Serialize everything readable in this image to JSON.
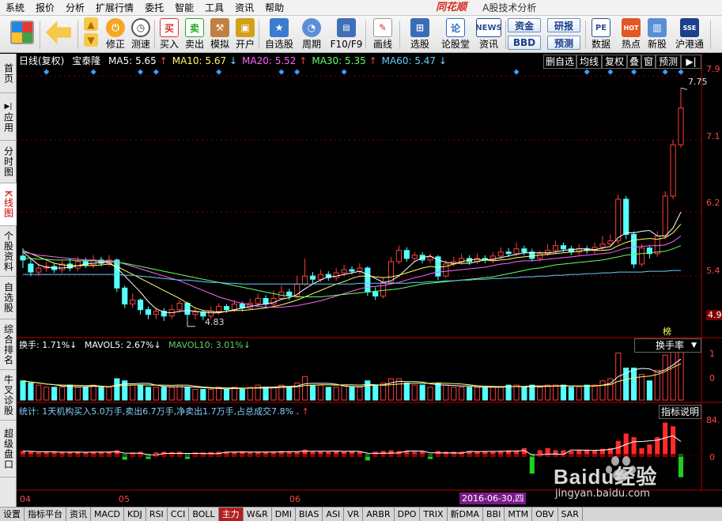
{
  "menu": {
    "items": [
      "系统",
      "报价",
      "分析",
      "扩展行情",
      "委托",
      "智能",
      "工具",
      "资讯",
      "帮助"
    ],
    "brand": "同花顺",
    "app_title": "A股技术分析"
  },
  "toolbar": {
    "buttons": [
      {
        "label": "修正",
        "icon": "fix-icon"
      },
      {
        "label": "测速",
        "icon": "speed-icon"
      },
      {
        "label": "买入",
        "icon": "buy-icon",
        "glyph": "买"
      },
      {
        "label": "卖出",
        "icon": "sell-icon",
        "glyph": "卖"
      },
      {
        "label": "模拟",
        "icon": "hammer-icon"
      },
      {
        "label": "开户",
        "icon": "lock-icon"
      },
      {
        "label": "自选股",
        "icon": "star-icon"
      },
      {
        "label": "周期",
        "icon": "clock-icon"
      },
      {
        "label": "F10/F9",
        "icon": "f10-icon"
      },
      {
        "label": "画线",
        "icon": "pencil-icon"
      },
      {
        "label": "选股",
        "icon": "select-stock-icon"
      },
      {
        "label": "论股堂",
        "icon": "forum-icon",
        "glyph": "论"
      },
      {
        "label": "资讯",
        "icon": "news-icon",
        "glyph": "NEWS"
      },
      {
        "label": "数据",
        "icon": "pe-icon",
        "glyph": "PE"
      },
      {
        "label": "热点",
        "icon": "hot-icon",
        "glyph": "HOT"
      },
      {
        "label": "新股",
        "icon": "ipo-icon"
      },
      {
        "label": "沪港通",
        "icon": "hk-connect-icon"
      }
    ],
    "pills": [
      "资金",
      "研报",
      "BBD",
      "预测"
    ]
  },
  "sidebar": {
    "items": [
      {
        "label": "首页"
      },
      {
        "label": "应用"
      },
      {
        "label": "分时图"
      },
      {
        "label": "K线图",
        "active": true
      },
      {
        "label": "个股资料"
      },
      {
        "label": "自选股"
      },
      {
        "label": "综合排名"
      },
      {
        "label": "牛叉诊股"
      },
      {
        "label": "超级盘口"
      }
    ]
  },
  "price_panel": {
    "period_label": "日线(复权)",
    "stock_name": "宝泰隆",
    "ma": [
      {
        "label": "MA5: 5.65",
        "arrow": "↑",
        "color": "#ffffff"
      },
      {
        "label": "MA10: 5.67",
        "arrow": "↓",
        "color": "#ffff66"
      },
      {
        "label": "MA20: 5.52",
        "arrow": "↑",
        "color": "#ff66ff"
      },
      {
        "label": "MA30: 5.35",
        "arrow": "↑",
        "color": "#66ff66"
      },
      {
        "label": "MA60: 5.47",
        "arrow": "↓",
        "color": "#66ccff"
      }
    ],
    "buttons": [
      "删自选",
      "均线",
      "复权",
      "叠",
      "窗",
      "预测"
    ],
    "y_ticks": [
      "7.9",
      "7.1",
      "6.2",
      "5.4",
      "4.9"
    ],
    "high_label": "7.75",
    "low_label": "4.83",
    "bang_label": "榜"
  },
  "volume_panel": {
    "label": "换手: 1.71%",
    "mavol5": "MAVOL5: 2.67%",
    "mavol10": "MAVOL10: 3.01%",
    "dropdown": "换手率",
    "y_ticks": [
      "1",
      "0"
    ]
  },
  "flow_panel": {
    "stat_text": "统计: 1天机构买入5.0万手,卖出6.7万手,净卖出1.7万手,占总成交7.8%",
    "button": "指标说明",
    "y_ticks": [
      "84.",
      "0"
    ]
  },
  "date_axis": {
    "months": [
      "04",
      "05",
      "06"
    ],
    "cursor_date": "2016-06-30,四"
  },
  "tabs": [
    "设置",
    "指标平台",
    "资讯",
    "MACD",
    "KDJ",
    "RSI",
    "CCI",
    "BOLL",
    "主力",
    "W&R",
    "DMI",
    "BIAS",
    "ASI",
    "VR",
    "ARBR",
    "DPO",
    "TRIX",
    "新DMA",
    "BBI",
    "MTM",
    "OBV",
    "SAR"
  ],
  "selected_tab": "主力",
  "watermark": {
    "text": "Baidu经验",
    "sub": "jingyan.baidu.com"
  },
  "chart_data": {
    "type": "candlestick",
    "symbol": "宝泰隆",
    "price_ylim": [
      4.7,
      8.0
    ],
    "candles": [
      [
        5.65,
        5.6,
        5.75,
        5.5
      ],
      [
        5.55,
        5.45,
        5.62,
        5.4
      ],
      [
        5.45,
        5.5,
        5.55,
        5.4
      ],
      [
        5.5,
        5.52,
        5.58,
        5.45
      ],
      [
        5.52,
        5.48,
        5.56,
        5.44
      ],
      [
        5.48,
        5.55,
        5.6,
        5.44
      ],
      [
        5.55,
        5.5,
        5.62,
        5.46
      ],
      [
        5.5,
        5.58,
        5.64,
        5.46
      ],
      [
        5.58,
        5.54,
        5.63,
        5.5
      ],
      [
        5.54,
        5.6,
        5.66,
        5.5
      ],
      [
        5.6,
        5.56,
        5.64,
        5.52
      ],
      [
        5.56,
        5.6,
        5.66,
        5.52
      ],
      [
        5.6,
        5.25,
        5.62,
        5.2
      ],
      [
        5.25,
        5.05,
        5.28,
        5.0
      ],
      [
        5.05,
        5.1,
        5.18,
        5.0
      ],
      [
        5.1,
        4.98,
        5.12,
        4.92
      ],
      [
        4.98,
        4.92,
        5.02,
        4.86
      ],
      [
        4.92,
        4.96,
        5.0,
        4.86
      ],
      [
        4.96,
        4.9,
        5.0,
        4.84
      ],
      [
        4.9,
        4.98,
        5.04,
        4.86
      ],
      [
        4.98,
        5.06,
        5.1,
        4.94
      ],
      [
        5.06,
        4.92,
        5.08,
        4.83
      ],
      [
        4.92,
        4.95,
        5.0,
        4.86
      ],
      [
        4.95,
        4.9,
        4.98,
        4.85
      ],
      [
        4.9,
        4.96,
        5.02,
        4.86
      ],
      [
        4.96,
        5.02,
        5.06,
        4.92
      ],
      [
        5.02,
        4.98,
        5.05,
        4.94
      ],
      [
        4.98,
        5.05,
        5.1,
        4.95
      ],
      [
        5.05,
        5.0,
        5.08,
        4.96
      ],
      [
        5.0,
        5.06,
        5.12,
        4.98
      ],
      [
        5.06,
        5.12,
        5.18,
        5.02
      ],
      [
        5.12,
        5.05,
        5.16,
        5.0
      ],
      [
        5.05,
        5.12,
        5.22,
        5.02
      ],
      [
        5.12,
        5.2,
        5.28,
        5.1
      ],
      [
        5.2,
        5.15,
        5.24,
        5.1
      ],
      [
        5.15,
        5.3,
        5.4,
        5.12
      ],
      [
        5.3,
        5.4,
        5.62,
        5.28
      ],
      [
        5.4,
        5.36,
        5.45,
        5.3
      ],
      [
        5.36,
        5.42,
        5.48,
        5.32
      ],
      [
        5.42,
        5.38,
        5.46,
        5.34
      ],
      [
        5.38,
        5.44,
        5.5,
        5.34
      ],
      [
        5.44,
        5.48,
        5.54,
        5.4
      ],
      [
        5.48,
        5.46,
        5.52,
        5.42
      ],
      [
        5.46,
        5.5,
        5.56,
        5.42
      ],
      [
        5.5,
        5.2,
        5.52,
        5.15
      ],
      [
        5.2,
        5.15,
        5.26,
        5.1
      ],
      [
        5.15,
        5.32,
        5.38,
        5.12
      ],
      [
        5.32,
        5.58,
        5.64,
        5.3
      ],
      [
        5.58,
        5.72,
        5.78,
        5.55
      ],
      [
        5.72,
        5.62,
        5.76,
        5.58
      ],
      [
        5.62,
        5.66,
        5.7,
        5.58
      ],
      [
        5.66,
        5.6,
        5.7,
        5.56
      ],
      [
        5.6,
        5.64,
        5.68,
        5.56
      ],
      [
        5.64,
        5.4,
        5.66,
        5.35
      ],
      [
        5.4,
        5.55,
        5.6,
        5.38
      ],
      [
        5.55,
        5.58,
        5.64,
        5.52
      ],
      [
        5.58,
        5.62,
        5.68,
        5.54
      ],
      [
        5.62,
        5.58,
        5.66,
        5.54
      ],
      [
        5.58,
        5.62,
        5.68,
        5.55
      ],
      [
        5.62,
        5.6,
        5.66,
        5.56
      ],
      [
        5.6,
        5.65,
        5.7,
        5.56
      ],
      [
        5.65,
        5.7,
        5.76,
        5.6
      ],
      [
        5.7,
        5.68,
        5.75,
        5.64
      ],
      [
        5.68,
        5.74,
        5.82,
        5.65
      ],
      [
        5.74,
        5.7,
        5.78,
        5.66
      ],
      [
        5.7,
        5.62,
        5.74,
        5.58
      ],
      [
        5.62,
        5.68,
        5.72,
        5.58
      ],
      [
        5.68,
        5.72,
        5.8,
        5.65
      ],
      [
        5.72,
        5.78,
        5.84,
        5.68
      ],
      [
        5.78,
        5.74,
        5.82,
        5.7
      ],
      [
        5.74,
        5.7,
        5.78,
        5.66
      ],
      [
        5.7,
        5.74,
        5.8,
        5.66
      ],
      [
        5.74,
        5.72,
        5.78,
        5.68
      ],
      [
        5.72,
        5.76,
        5.82,
        5.68
      ],
      [
        5.76,
        5.8,
        5.9,
        5.72
      ],
      [
        5.8,
        5.84,
        5.92,
        5.76
      ],
      [
        5.84,
        6.36,
        6.42,
        5.8
      ],
      [
        6.36,
        5.92,
        6.4,
        5.86
      ],
      [
        5.92,
        5.55,
        5.96,
        5.5
      ],
      [
        5.55,
        5.75,
        5.8,
        5.52
      ],
      [
        5.75,
        5.68,
        5.78,
        5.62
      ],
      [
        5.68,
        5.9,
        5.96,
        5.64
      ],
      [
        5.9,
        6.4,
        6.46,
        5.86
      ],
      [
        6.4,
        7.04,
        7.1,
        6.36
      ],
      [
        7.04,
        7.5,
        7.75,
        7.0
      ]
    ],
    "ma_lines": [
      {
        "name": "MA5",
        "color": "#ffffff",
        "values": [
          5.7,
          5.62,
          5.54,
          5.51,
          5.5,
          5.5,
          5.51,
          5.53,
          5.55,
          5.56,
          5.57,
          5.57,
          5.5,
          5.4,
          5.3,
          5.2,
          5.08,
          4.99,
          4.95,
          4.94,
          4.96,
          4.97,
          4.96,
          4.95,
          4.94,
          4.94,
          4.96,
          4.98,
          5.0,
          5.02,
          5.04,
          5.05,
          5.07,
          5.11,
          5.13,
          5.17,
          5.24,
          5.3,
          5.35,
          5.39,
          5.4,
          5.42,
          5.44,
          5.46,
          5.42,
          5.37,
          5.32,
          5.34,
          5.4,
          5.49,
          5.58,
          5.63,
          5.65,
          5.6,
          5.57,
          5.56,
          5.56,
          5.56,
          5.58,
          5.6,
          5.61,
          5.63,
          5.65,
          5.67,
          5.69,
          5.69,
          5.69,
          5.69,
          5.7,
          5.72,
          5.73,
          5.74,
          5.74,
          5.73,
          5.75,
          5.77,
          5.88,
          5.94,
          5.94,
          5.96,
          5.97,
          5.9,
          5.9,
          6.0,
          6.2
        ]
      },
      {
        "name": "MA10",
        "color": "#ffff66",
        "values": [
          5.72,
          5.68,
          5.64,
          5.6,
          5.56,
          5.54,
          5.53,
          5.53,
          5.53,
          5.53,
          5.54,
          5.55,
          5.52,
          5.47,
          5.42,
          5.37,
          5.32,
          5.27,
          5.22,
          5.17,
          5.12,
          5.06,
          5.0,
          4.97,
          4.96,
          4.95,
          4.96,
          4.97,
          4.97,
          4.98,
          4.99,
          5.0,
          5.02,
          5.04,
          5.07,
          5.1,
          5.14,
          5.18,
          5.22,
          5.26,
          5.3,
          5.33,
          5.37,
          5.4,
          5.4,
          5.39,
          5.38,
          5.39,
          5.41,
          5.44,
          5.47,
          5.5,
          5.52,
          5.51,
          5.52,
          5.55,
          5.58,
          5.6,
          5.61,
          5.6,
          5.59,
          5.6,
          5.61,
          5.63,
          5.64,
          5.65,
          5.66,
          5.67,
          5.68,
          5.69,
          5.7,
          5.71,
          5.72,
          5.72,
          5.72,
          5.73,
          5.78,
          5.82,
          5.85,
          5.86,
          5.87,
          5.86,
          5.88,
          5.94,
          6.05
        ]
      },
      {
        "name": "MA20",
        "color": "#ff66ff",
        "values": [
          5.7,
          5.68,
          5.66,
          5.65,
          5.64,
          5.63,
          5.62,
          5.61,
          5.6,
          5.6,
          5.59,
          5.59,
          5.58,
          5.55,
          5.52,
          5.49,
          5.46,
          5.43,
          5.4,
          5.37,
          5.34,
          5.3,
          5.26,
          5.22,
          5.18,
          5.14,
          5.11,
          5.08,
          5.06,
          5.04,
          5.02,
          5.01,
          5.01,
          5.01,
          5.02,
          5.03,
          5.05,
          5.07,
          5.09,
          5.12,
          5.15,
          5.18,
          5.21,
          5.24,
          5.26,
          5.27,
          5.28,
          5.3,
          5.32,
          5.35,
          5.38,
          5.4,
          5.43,
          5.45,
          5.46,
          5.47,
          5.48,
          5.49,
          5.5,
          5.51,
          5.53,
          5.55,
          5.56,
          5.58,
          5.59,
          5.59,
          5.6,
          5.61,
          5.62,
          5.63,
          5.64,
          5.65,
          5.66,
          5.67,
          5.68,
          5.69,
          5.72,
          5.75,
          5.76,
          5.77,
          5.78,
          5.78,
          5.79,
          5.83,
          5.9
        ]
      },
      {
        "name": "MA30",
        "color": "#66ff66",
        "values": [
          5.62,
          5.62,
          5.61,
          5.61,
          5.6,
          5.6,
          5.6,
          5.59,
          5.59,
          5.59,
          5.58,
          5.58,
          5.57,
          5.56,
          5.54,
          5.52,
          5.5,
          5.48,
          5.46,
          5.44,
          5.42,
          5.4,
          5.38,
          5.36,
          5.34,
          5.32,
          5.3,
          5.28,
          5.26,
          5.24,
          5.22,
          5.2,
          5.18,
          5.16,
          5.15,
          5.14,
          5.14,
          5.14,
          5.14,
          5.15,
          5.16,
          5.17,
          5.18,
          5.19,
          5.2,
          5.21,
          5.22,
          5.23,
          5.24,
          5.26,
          5.28,
          5.3,
          5.31,
          5.32,
          5.33,
          5.34,
          5.35,
          5.36,
          5.37,
          5.38,
          5.39,
          5.41,
          5.43,
          5.45,
          5.47,
          5.49,
          5.5,
          5.52,
          5.54,
          5.55,
          5.56,
          5.57,
          5.58,
          5.59,
          5.6,
          5.62,
          5.64,
          5.66,
          5.67,
          5.68,
          5.69,
          5.7,
          5.71,
          5.74,
          5.78
        ]
      },
      {
        "name": "MA60",
        "color": "#66ccff",
        "values": [
          5.42,
          5.42,
          5.42,
          5.42,
          5.42,
          5.42,
          5.42,
          5.42,
          5.42,
          5.42,
          5.42,
          5.42,
          5.42,
          5.41,
          5.41,
          5.4,
          5.39,
          5.38,
          5.37,
          5.36,
          5.35,
          5.35,
          5.34,
          5.33,
          5.32,
          5.32,
          5.31,
          5.31,
          5.3,
          5.3,
          5.3,
          5.3,
          5.3,
          5.3,
          5.3,
          5.3,
          5.3,
          5.3,
          5.3,
          5.3,
          5.3,
          5.3,
          5.3,
          5.31,
          5.31,
          5.31,
          5.31,
          5.31,
          5.31,
          5.31,
          5.32,
          5.32,
          5.33,
          5.33,
          5.34,
          5.34,
          5.35,
          5.35,
          5.36,
          5.36,
          5.37,
          5.37,
          5.38,
          5.38,
          5.39,
          5.39,
          5.4,
          5.4,
          5.41,
          5.41,
          5.42,
          5.42,
          5.43,
          5.43,
          5.44,
          5.44,
          5.45,
          5.45,
          5.45,
          5.45,
          5.46,
          5.46,
          5.46,
          5.47,
          5.47
        ]
      }
    ],
    "turnover": [
      0.9,
      0.8,
      0.7,
      0.6,
      0.6,
      0.6,
      0.7,
      0.6,
      0.6,
      0.7,
      0.6,
      0.6,
      1.0,
      0.9,
      0.7,
      0.7,
      0.6,
      0.6,
      0.6,
      0.6,
      0.7,
      0.6,
      0.5,
      0.5,
      0.5,
      0.6,
      0.5,
      0.6,
      0.5,
      0.6,
      0.7,
      0.6,
      0.6,
      0.7,
      0.6,
      0.8,
      1.1,
      0.7,
      0.7,
      0.6,
      0.6,
      0.7,
      0.6,
      0.6,
      0.9,
      0.7,
      0.8,
      1.0,
      1.0,
      0.8,
      0.7,
      0.7,
      0.6,
      0.8,
      0.7,
      0.6,
      0.6,
      0.6,
      0.6,
      0.6,
      0.6,
      0.6,
      0.7,
      0.7,
      0.6,
      0.7,
      0.6,
      0.7,
      0.7,
      0.7,
      0.6,
      0.6,
      0.7,
      0.7,
      0.9,
      1.0,
      2.2,
      1.5,
      1.5,
      1.2,
      0.9,
      1.4,
      2.1,
      2.6,
      2.6
    ],
    "main_force": [
      0.12,
      0.1,
      0.08,
      0.1,
      0.09,
      0.08,
      0.1,
      0.09,
      0.08,
      0.1,
      0.09,
      0.1,
      0.14,
      -0.12,
      0.08,
      0.1,
      -0.1,
      0.08,
      0.1,
      0.09,
      0.1,
      -0.1,
      0.08,
      0.08,
      0.09,
      0.1,
      0.1,
      0.09,
      0.1,
      0.08,
      0.1,
      0.09,
      0.1,
      0.12,
      0.1,
      0.1,
      0.16,
      0.1,
      0.12,
      0.1,
      0.12,
      0.1,
      0.12,
      0.1,
      -0.14,
      0.1,
      0.12,
      0.14,
      0.12,
      0.12,
      0.1,
      0.12,
      -0.1,
      0.12,
      0.1,
      0.1,
      0.1,
      0.12,
      0.1,
      0.12,
      0.1,
      0.12,
      0.14,
      0.12,
      0.2,
      -0.5,
      0.14,
      0.2,
      0.14,
      0.14,
      0.12,
      0.14,
      0.16,
      0.14,
      0.18,
      0.2,
      0.4,
      0.6,
      0.5,
      0.2,
      0.3,
      0.5,
      0.9,
      0.8,
      -0.6
    ]
  }
}
